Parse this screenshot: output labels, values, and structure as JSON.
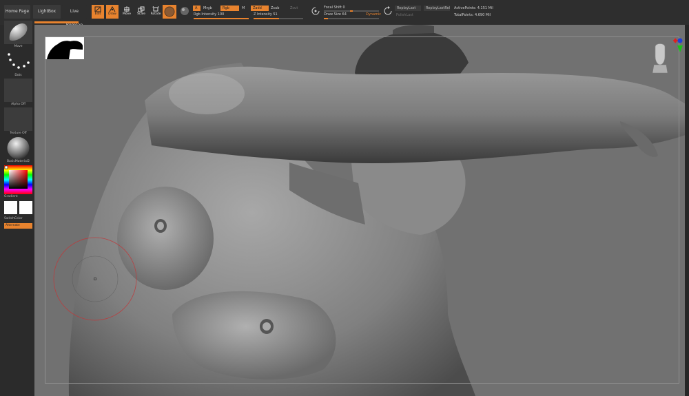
{
  "nav": {
    "home_page": "Home Page",
    "lightbox": "LightBox",
    "live_boolean": "Live Boolean"
  },
  "tools": {
    "edit": "Edit",
    "draw": "Draw",
    "move": "Move",
    "scale": "Scale",
    "rotate": "Rotate"
  },
  "brush_settings": {
    "a": "A",
    "mrgb": "Mrgb",
    "rgb": "Rgb",
    "m": "M",
    "zadd": "Zadd",
    "zsub": "Zsub",
    "zcut": "Zcut",
    "rgb_intensity_label": "Rgb Intensity",
    "rgb_intensity": "100",
    "z_intensity_label": "Z Intensity",
    "z_intensity": "51",
    "z_intensity_fraction": 0.51,
    "focal_shift_label": "Focal Shift",
    "focal_shift": "0",
    "draw_size_label": "Draw Size",
    "draw_size": "64",
    "draw_size_fraction": 0.07,
    "dynamic": "Dynamic"
  },
  "replay": {
    "replay_last": "ReplayLast",
    "replay_last_rel": "ReplayLastRel",
    "polish_label": "PolishLast"
  },
  "stats": {
    "active_points_label": "ActivePoints:",
    "active_points": "4.151 Mil",
    "total_points_label": "TotalPoints:",
    "total_points": "4.690 Mil"
  },
  "left_panel": {
    "brush": "Move",
    "stroke": "Dots",
    "alpha": "Alpha Off",
    "texture": "Texture Off",
    "material": "BasicMaterial2",
    "gradient": "Gradient",
    "switch_color": "SwitchColor",
    "alternate": "Alternate"
  },
  "colors": {
    "accent": "#e8832e",
    "canvas": "#717171",
    "panel": "#2e2e2e",
    "brush_cursor": "#c0393b"
  },
  "icons": [
    "edit-icon",
    "draw-icon",
    "move-icon",
    "scale-icon",
    "rotate-icon",
    "sphere-icon",
    "focal-shift-icon",
    "draw-size-icon",
    "axis-gizmo-icon",
    "head-navigation-icon"
  ]
}
